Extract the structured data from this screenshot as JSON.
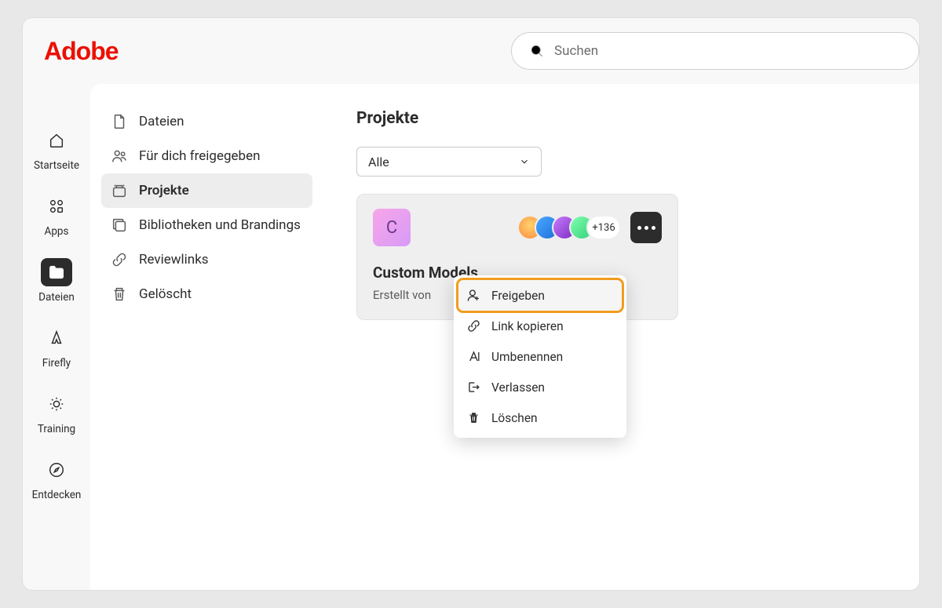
{
  "brand": "Adobe",
  "search": {
    "placeholder": "Suchen"
  },
  "rail": {
    "home": "Startseite",
    "apps": "Apps",
    "files": "Dateien",
    "firefly": "Firefly",
    "training": "Training",
    "discover": "Entdecken"
  },
  "panel": {
    "files": "Dateien",
    "shared": "Für dich freigegeben",
    "projects": "Projekte",
    "libraries": "Bibliotheken und Brandings",
    "reviewlinks": "Reviewlinks",
    "deleted": "Gelöscht"
  },
  "main": {
    "title": "Projekte",
    "filter": "Alle",
    "project": {
      "initial": "C",
      "name": "Custom Models",
      "subtitle": "Erstellt von",
      "more_count": "+136"
    }
  },
  "menu": {
    "share": "Freigeben",
    "copy_link": "Link kopieren",
    "rename": "Umbenennen",
    "leave": "Verlassen",
    "delete": "Löschen"
  }
}
